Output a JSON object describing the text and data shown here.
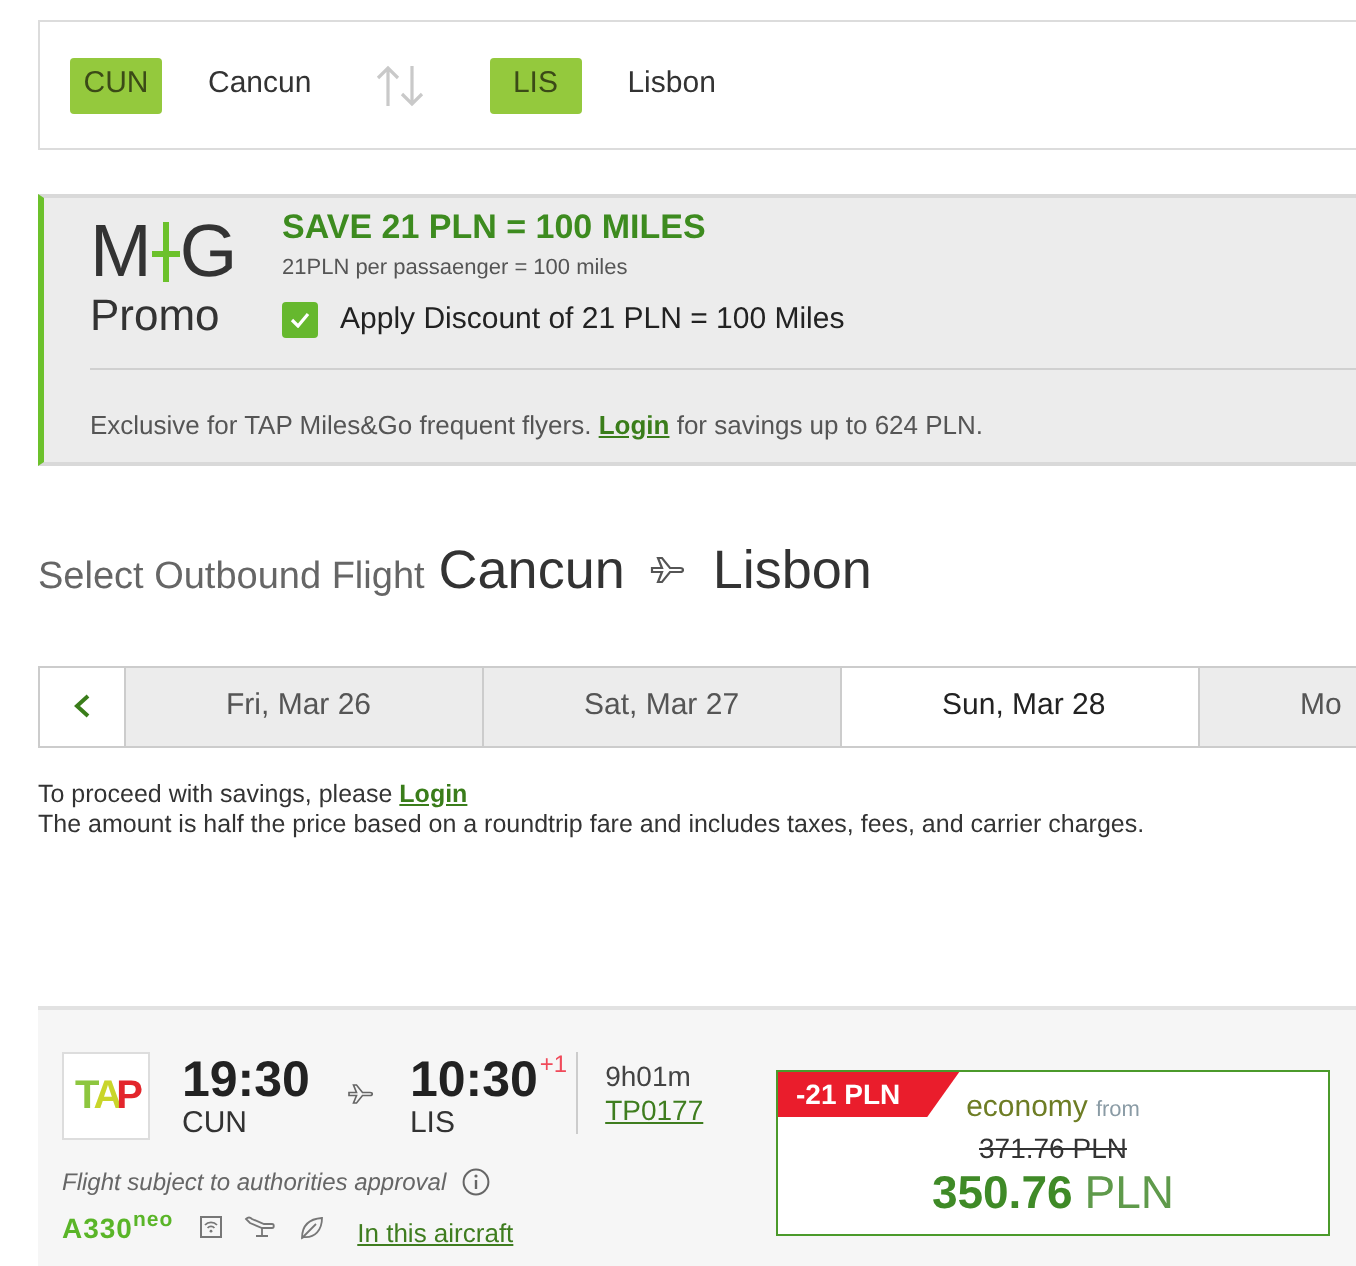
{
  "route": {
    "origin": {
      "code": "CUN",
      "city": "Cancun"
    },
    "destination": {
      "code": "LIS",
      "city": "Lisbon"
    }
  },
  "promo": {
    "logo": {
      "letters": [
        "M",
        "G"
      ],
      "caption": "Promo"
    },
    "title": "SAVE 21 PLN = 100 MILES",
    "subtitle": "21PLN per passaenger = 100 miles",
    "apply": {
      "label": "Apply Discount of 21 PLN = 100 Miles",
      "checked": true
    },
    "footer": {
      "before": "Exclusive for TAP Miles&Go frequent flyers.",
      "link": "Login",
      "after": "for savings up to 624 PLN."
    }
  },
  "heading": {
    "label": "Select Outbound Flight",
    "origin": "Cancun",
    "destination": "Lisbon"
  },
  "date_tabs": [
    {
      "label": "Fri, Mar 26",
      "selected": false
    },
    {
      "label": "Sat, Mar 27",
      "selected": false
    },
    {
      "label": "Sun, Mar 28",
      "selected": true
    },
    {
      "label": "Mo",
      "selected": false
    }
  ],
  "notice": {
    "line_1": "To proceed with savings, please",
    "link": "Login",
    "line_2": "The amount is half the price based on a roundtrip fare and includes taxes, fees, and carrier charges."
  },
  "flight": {
    "airline_logo": "TAP",
    "departure": {
      "time": "19:30",
      "code": "CUN"
    },
    "arrival": {
      "time": "10:30",
      "code": "LIS",
      "day_offset": "+1"
    },
    "duration": "9h01m",
    "flight_number": "TP0177",
    "note": "Flight subject to authorities approval",
    "aircraft": "A330$^{neo}$",
    "aircraft_link": "In this aircraft",
    "fare": {
      "discount": "-21 PLN",
      "cabin": "economy",
      "from": "from",
      "old_price": "371.76 PLN",
      "amount": "350.76",
      "currency": "PLN"
    }
  }
}
